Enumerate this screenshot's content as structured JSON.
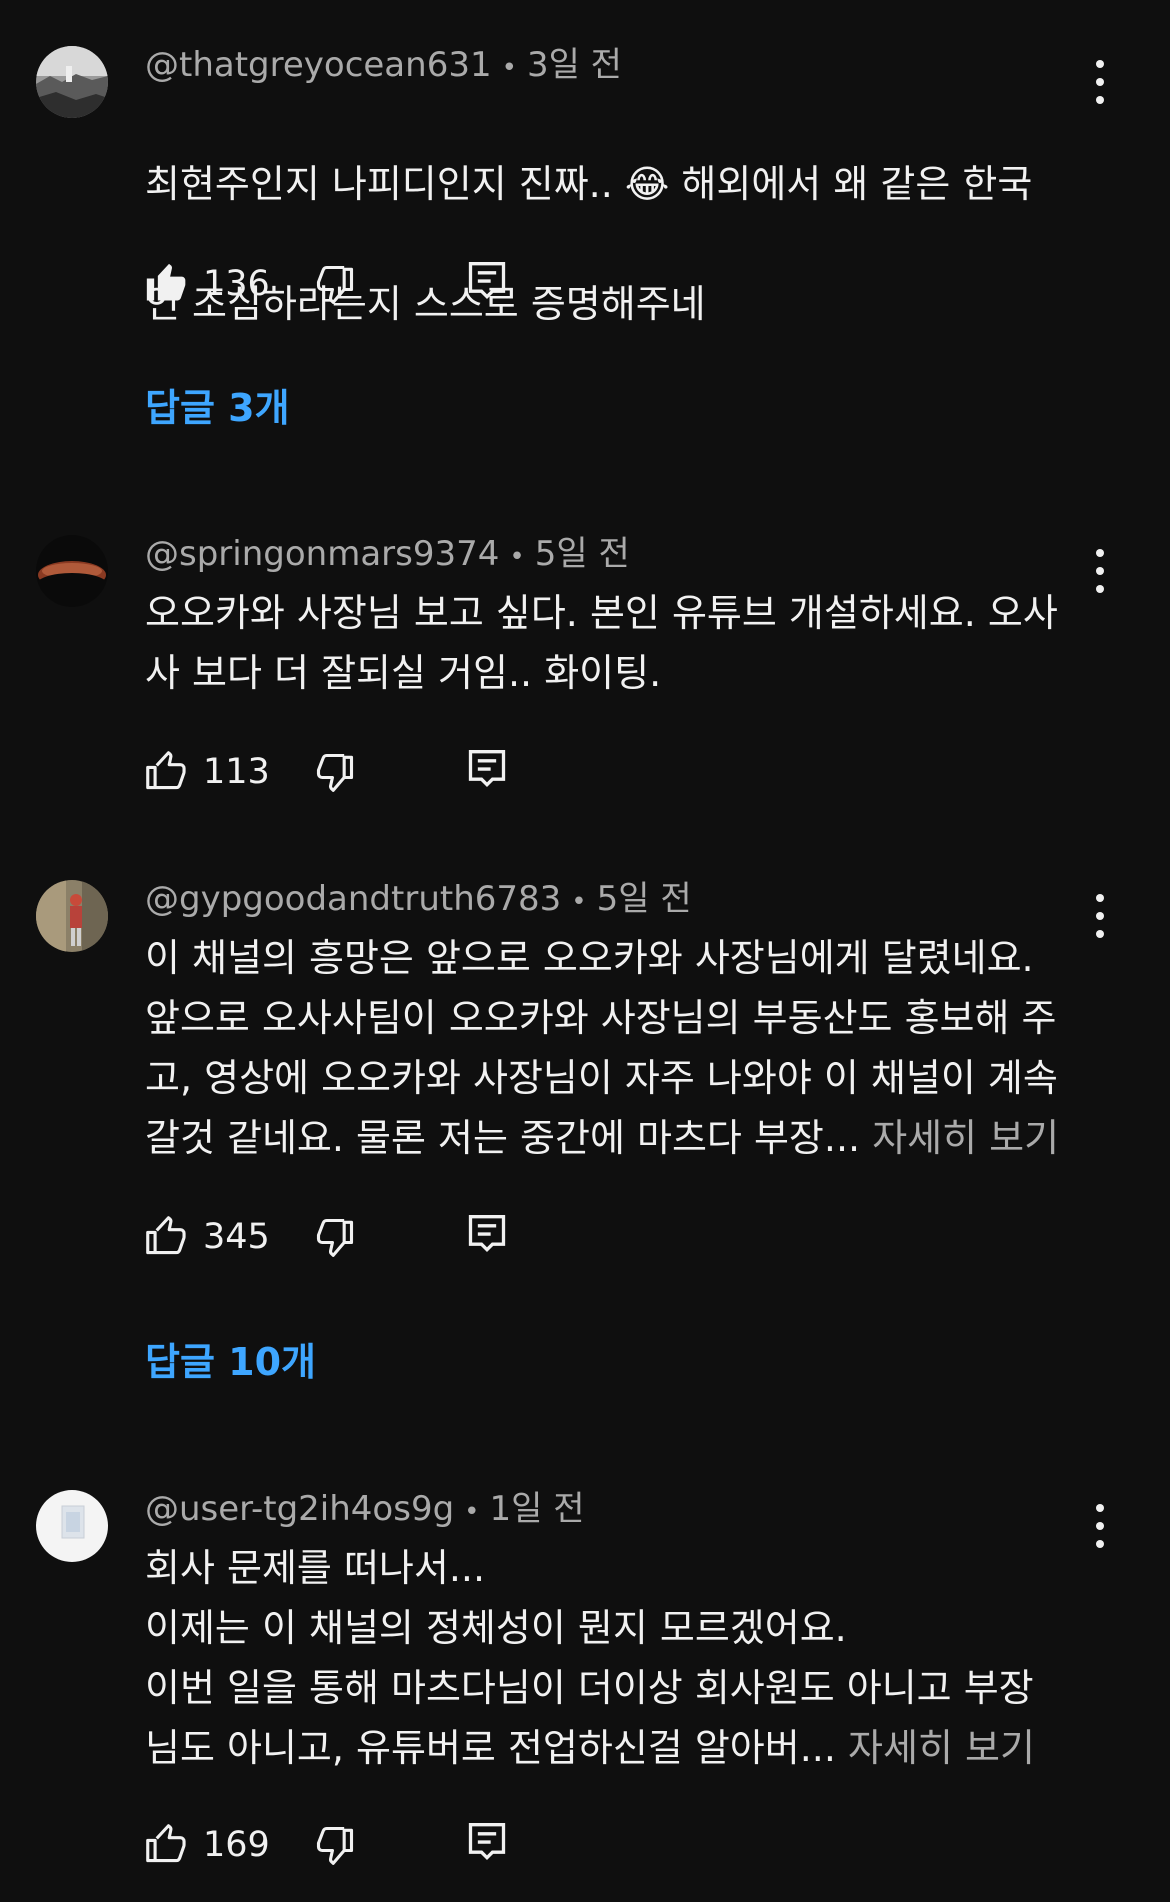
{
  "comments": [
    {
      "author": "@thatgreyocean631",
      "time": "3일 전",
      "text_line1": "최현주인지 나피디인지 진짜.. ",
      "emoji": "😂",
      "text_line1_end": " 해외에서 왜 같은 한국",
      "text_line2": "인 조심하라는지 스스로 증명해주네",
      "likes": "136",
      "liked": true,
      "replies": "답글 3개"
    },
    {
      "author": "@springonmars9374",
      "time": "5일 전",
      "text": "오오카와 사장님 보고 싶다. 본인 유튜브 개설하세요. 오사\n사 보다 더 잘되실 거임.. 화이팅.",
      "likes": "113",
      "liked": false
    },
    {
      "author": "@gypgoodandtruth6783",
      "time": "5일 전",
      "text": "이 채널의 흥망은 앞으로 오오카와 사장님에게 달렸네요.\n앞으로 오사사팀이 오오카와 사장님의 부동산도 홍보해 주\n고, 영상에 오오카와 사장님이 자주 나와야 이 채널이 계속\n갈것 같네요. 물론 저는 중간에 마츠다 부장... ",
      "more": "자세히 보기",
      "likes": "345",
      "liked": false,
      "replies": "답글 10개"
    },
    {
      "author": "@user-tg2ih4os9g",
      "time": "1일 전",
      "text": "회사 문제를 떠나서...\n이제는 이 채널의 정체성이 뭔지 모르겠어요.\n이번 일을 통해 마츠다님이 더이상 회사원도 아니고 부장\n님도 아니고, 유튜버로 전업하신걸 알아버... ",
      "more": "자세히 보기",
      "likes": "169",
      "liked": false
    }
  ],
  "separator": "•",
  "colors": {
    "background": "#0f0f0f",
    "text": "#f1f1f1",
    "meta": "#aaaaaa",
    "link": "#3ea6ff"
  },
  "icons": [
    "thumbs-up-icon",
    "thumbs-up-filled-icon",
    "thumbs-down-icon",
    "reply-icon",
    "more-vert-icon"
  ]
}
